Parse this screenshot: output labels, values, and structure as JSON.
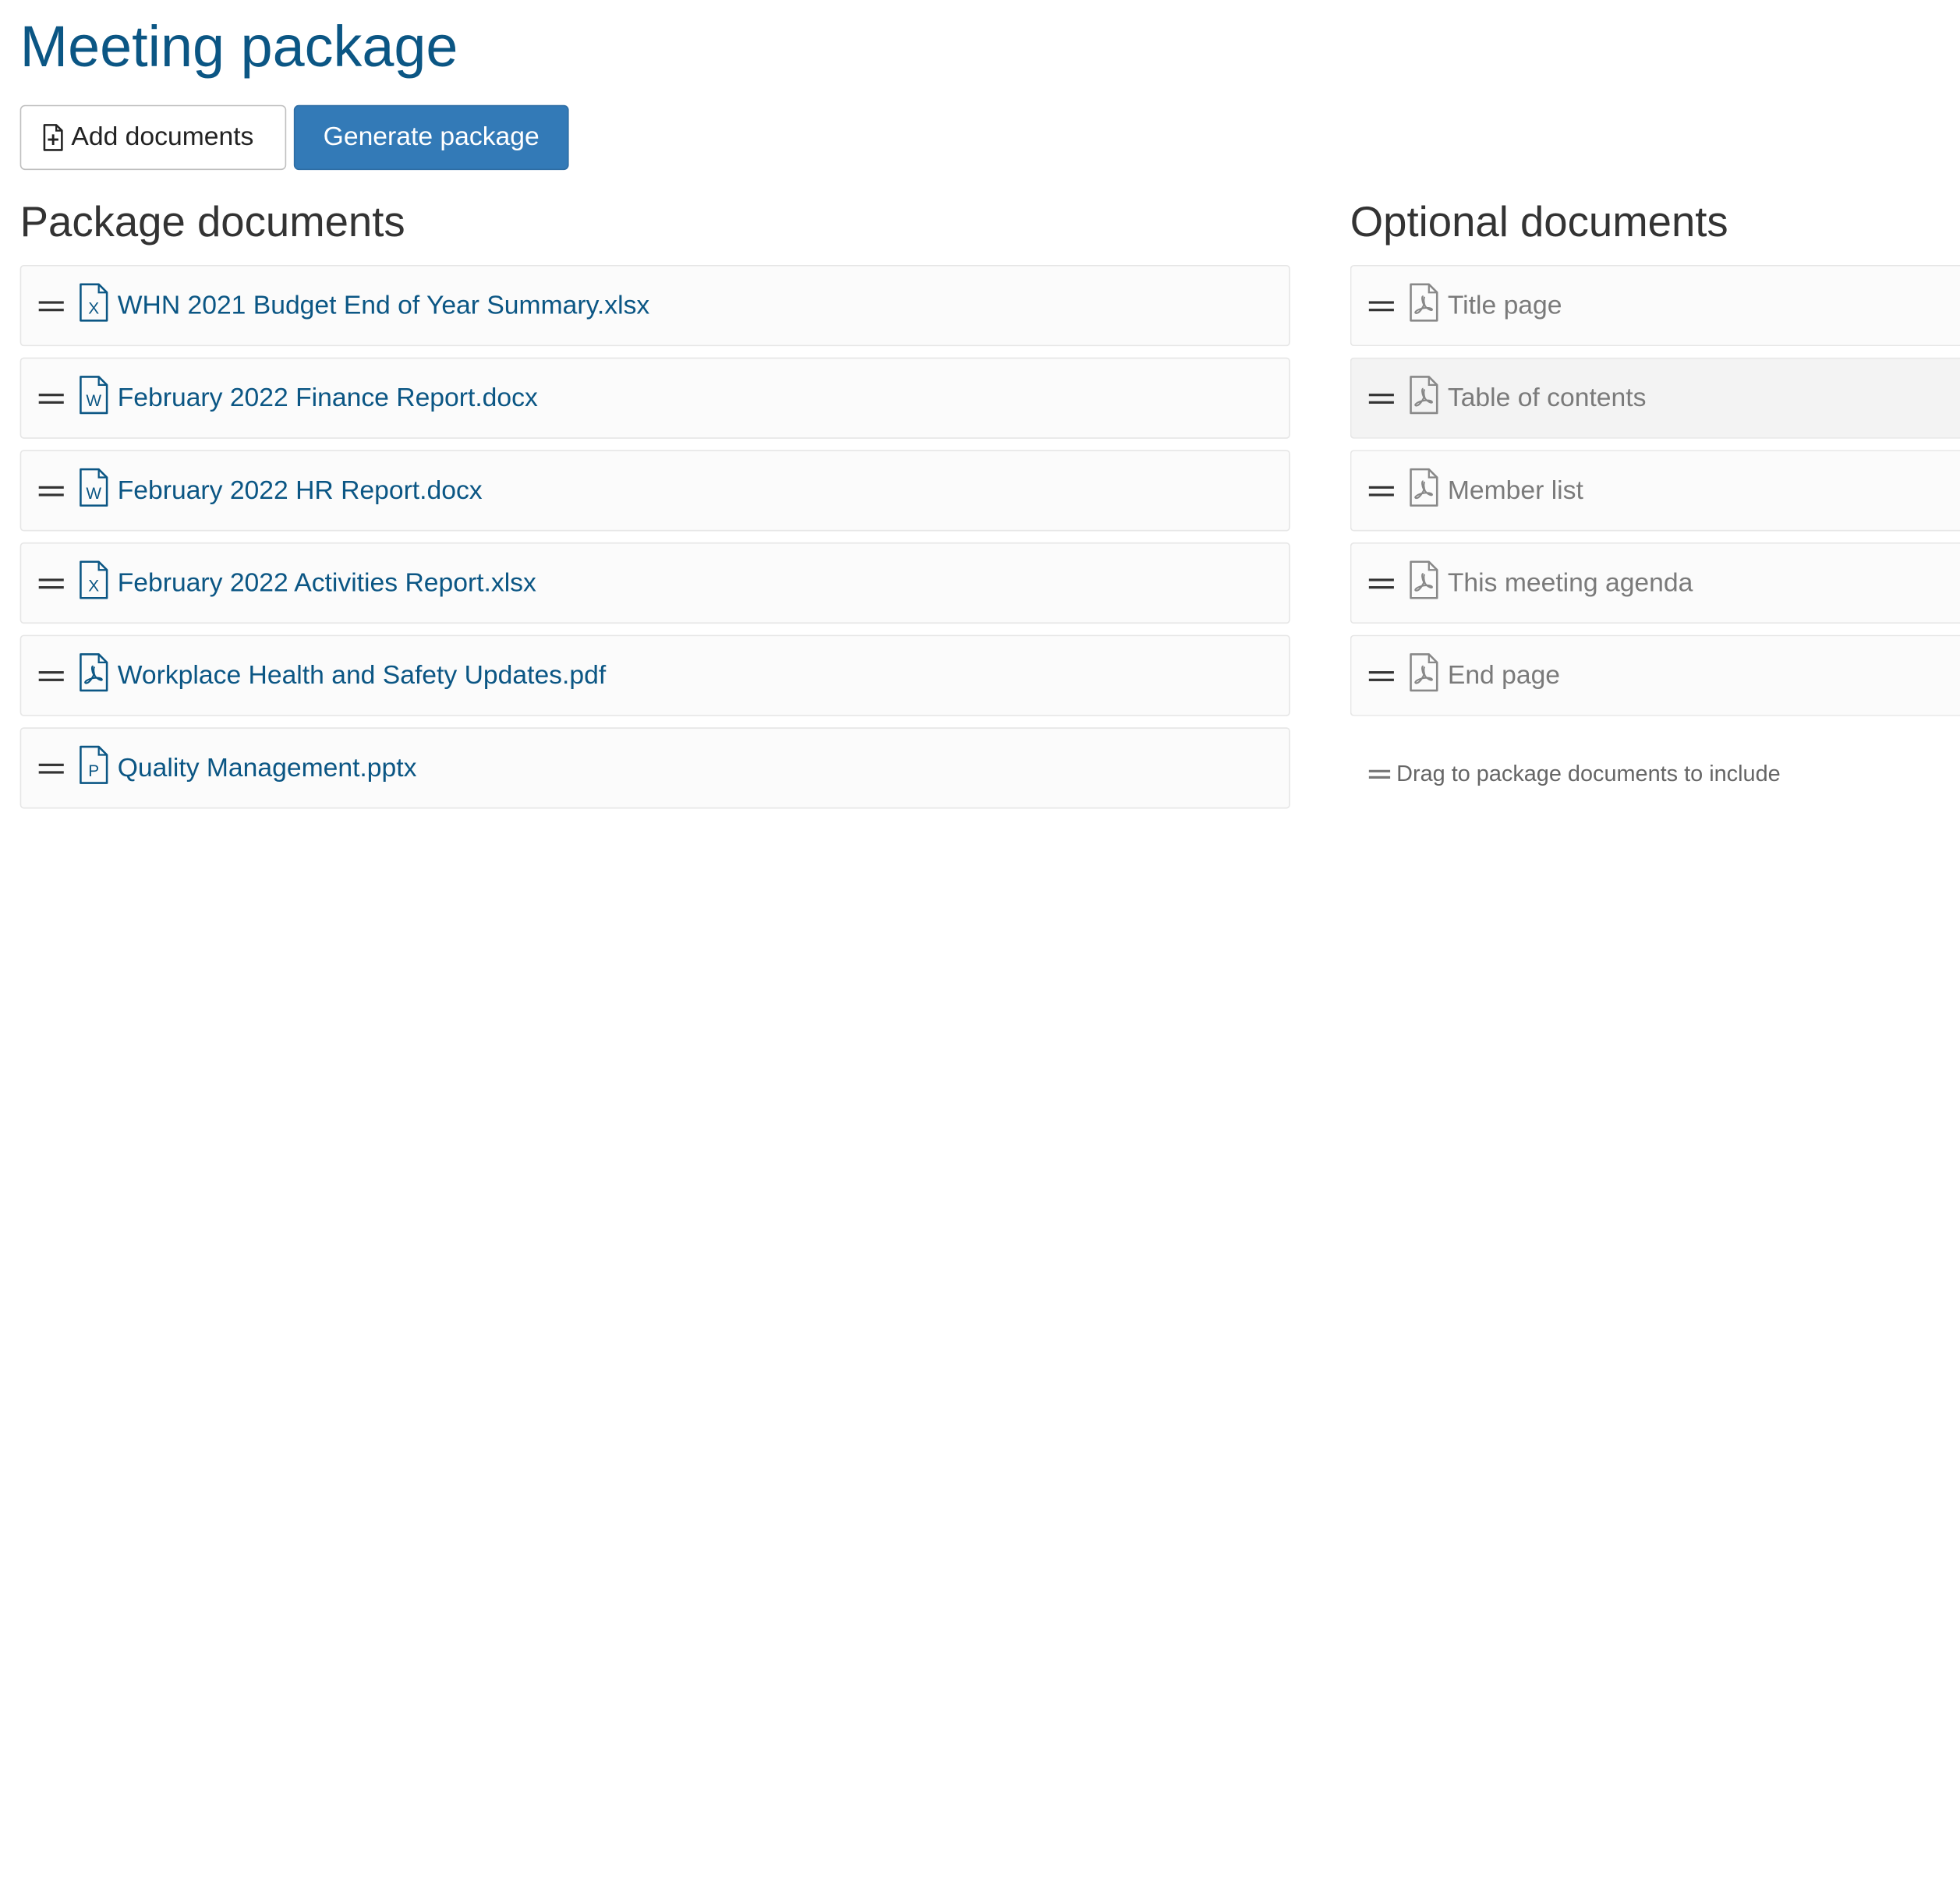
{
  "page": {
    "title": "Meeting package"
  },
  "toolbar": {
    "add_documents_label": "Add documents",
    "add_documents_icon": "file-plus-icon",
    "generate_package_label": "Generate package"
  },
  "package_documents": {
    "heading": "Package documents",
    "items": [
      {
        "name": "WHN 2021 Budget End of Year Summary.xlsx",
        "icon": "excel-file-icon"
      },
      {
        "name": "February 2022 Finance Report.docx",
        "icon": "word-file-icon"
      },
      {
        "name": "February 2022 HR Report.docx",
        "icon": "word-file-icon"
      },
      {
        "name": "February 2022 Activities Report.xlsx",
        "icon": "excel-file-icon"
      },
      {
        "name": "Workplace Health and Safety Updates.pdf",
        "icon": "pdf-file-icon"
      },
      {
        "name": "Quality Management.pptx",
        "icon": "powerpoint-file-icon"
      }
    ]
  },
  "optional_documents": {
    "heading": "Optional documents",
    "items": [
      {
        "name": "Title page",
        "icon": "pdf-file-icon"
      },
      {
        "name": "Table of contents",
        "icon": "pdf-file-icon"
      },
      {
        "name": "Member list",
        "icon": "pdf-file-icon"
      },
      {
        "name": "This meeting agenda",
        "icon": "pdf-file-icon"
      },
      {
        "name": "End page",
        "icon": "pdf-file-icon"
      }
    ],
    "hint": "Drag to package documents to include"
  },
  "colors": {
    "title": "#0b5684",
    "link": "#0b5684",
    "primary_button": "#337ab7",
    "muted_text": "#7a7a7a"
  }
}
